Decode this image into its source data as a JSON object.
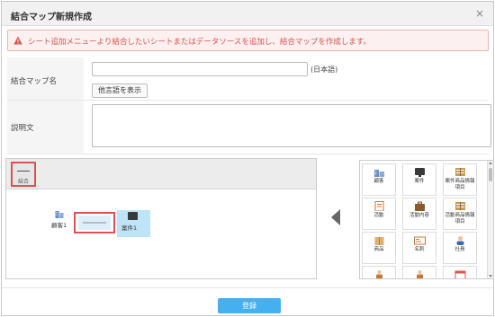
{
  "dialog": {
    "title": "結合マップ新規作成",
    "close_glyph": "×"
  },
  "alert": {
    "message": "シート追加メニューより結合したいシートまたはデータソースを追加し、結合マップを作成します。",
    "color": "#d9534f"
  },
  "form": {
    "name_label": "結合マップ名",
    "name_value": "",
    "name_suffix": "(日本語)",
    "lang_button": "他言語を表示",
    "desc_label": "説明文",
    "desc_value": ""
  },
  "canvas": {
    "join_tool_label": "結合",
    "nodes": {
      "left": "顧客1",
      "right": "案件1"
    }
  },
  "palette": {
    "items": [
      {
        "label": "顧客",
        "icon": "building-icon"
      },
      {
        "label": "案件",
        "icon": "monitor-icon"
      },
      {
        "label": "案件商品情報項目",
        "icon": "box-table-icon"
      },
      {
        "label": "活動",
        "icon": "document-icon"
      },
      {
        "label": "活動内容",
        "icon": "briefcase-icon"
      },
      {
        "label": "活動商品情報項目",
        "icon": "box-table-icon"
      },
      {
        "label": "商品",
        "icon": "package-icon"
      },
      {
        "label": "名刺",
        "icon": "card-icon"
      },
      {
        "label": "社員",
        "icon": "person-icon"
      },
      {
        "label": "",
        "icon": "org-icon"
      },
      {
        "label": "",
        "icon": "org-icon"
      },
      {
        "label": "",
        "icon": "calendar-icon"
      }
    ]
  },
  "footer": {
    "register_button": "登録"
  },
  "colors": {
    "accent": "#45b0f0",
    "highlight": "#e05050",
    "selected_node": "#bfe4f7"
  }
}
